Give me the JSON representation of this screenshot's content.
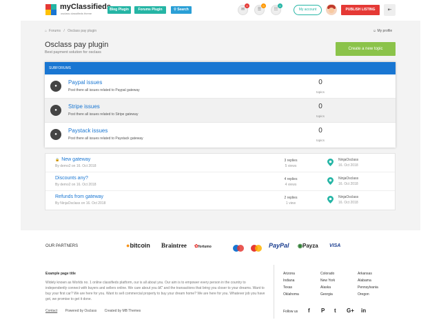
{
  "header": {
    "logo_title": "myClassifieds",
    "logo_tag": "osclass classifieds theme",
    "blog_btn": "Blog Plugin",
    "forums_btn": "Forums Plugin",
    "search_btn": "Search",
    "badges": [
      "0",
      "0",
      "0"
    ],
    "my_account": "My account",
    "publish": "PUBLISH LISTING"
  },
  "breadcrumb": {
    "home": "Forums",
    "sep": "/",
    "current": "Osclass pay plugin"
  },
  "my_profile": "My profile",
  "page": {
    "title": "Osclass pay plugin",
    "subtitle": "Best payment solution for osclass"
  },
  "new_topic": "Create a new topic",
  "subforums": {
    "header": "SUBFORUMS",
    "items": [
      {
        "title": "Paypal issues",
        "desc": "Post there all issues related to Paypal gateway",
        "count": "0",
        "label": "topics"
      },
      {
        "title": "Stripe issues",
        "desc": "Post there all issues related to Stripe gateway",
        "count": "0",
        "label": "topics"
      },
      {
        "title": "Paystack issues",
        "desc": "Post there all issues related to Paystack gateway",
        "count": "0",
        "label": "topics"
      }
    ]
  },
  "topics": [
    {
      "title": "New gateway",
      "by": "By demo2 on 16. Oct 2018",
      "replies": "3 replies",
      "views": "5 views",
      "last_user": "NinjaOsclass",
      "last_date": "16. Oct 2018"
    },
    {
      "title": "Discounts any?",
      "by": "By demo2 on 16. Oct 2018",
      "replies": "4 replies",
      "views": "4 views",
      "last_user": "NinjaOsclass",
      "last_date": "16. Oct 2018"
    },
    {
      "title": "Refunds from gateway",
      "by": "By NinjaOsclass on 16. Oct 2018",
      "replies": "2 replies",
      "views": "1 view",
      "last_user": "NinjaOsclass",
      "last_date": "16. Oct 2018"
    }
  ],
  "footer": {
    "partners_label": "OUR PARTNERS",
    "partners": [
      "bitcoin",
      "Braintree",
      "fortumo",
      "PayPal",
      "Payza",
      "VISA"
    ],
    "title": "Example page title",
    "text": "Widely known as Worlds no. 1 online classifieds platform, our is all about you. Our aim is to empower every person in the country to independently connect with buyers and sellers online. We care about you â€” and the transactions that bring you closer to your dreams. Want to buy your first car? We are here for you. Want to sell commercial property to buy your dream home? We are here for you. Whatever job you have got, we promise to get it done.",
    "links": [
      "Contact",
      "Powered by Osclass",
      "Created by MB Themes"
    ],
    "locations": [
      [
        "Arizona",
        "Indiana",
        "Texas",
        "Oklahoma"
      ],
      [
        "Colorado",
        "New York",
        "Alaska",
        "Georgia"
      ],
      [
        "Arkansas",
        "Alabama",
        "Pennsylvania",
        "Oregon"
      ]
    ],
    "follow_us": "Follow us",
    "social": [
      "f",
      "P",
      "t",
      "G+",
      "in"
    ]
  }
}
